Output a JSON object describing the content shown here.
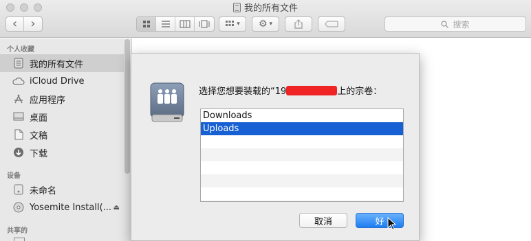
{
  "window": {
    "title": "我的所有文件",
    "search_placeholder": "搜索"
  },
  "toolbar": {
    "back_glyph": "‹",
    "forward_glyph": "›",
    "view_icons": [
      "view-icons-icon",
      "view-list-icon",
      "view-columns-icon",
      "view-coverflow-icon"
    ],
    "arrange_glyph": "▾",
    "action_glyph": "▾"
  },
  "sidebar": {
    "favorites_header": "个人收藏",
    "favorites": [
      {
        "label": "我的所有文件",
        "icon": "all-files-icon",
        "selected": true
      },
      {
        "label": "iCloud Drive",
        "icon": "cloud-icon"
      },
      {
        "label": "应用程序",
        "icon": "applications-icon"
      },
      {
        "label": "桌面",
        "icon": "desktop-icon"
      },
      {
        "label": "文稿",
        "icon": "documents-icon"
      },
      {
        "label": "下载",
        "icon": "downloads-icon"
      }
    ],
    "devices_header": "设备",
    "devices": [
      {
        "label": "未命名",
        "icon": "disk-icon"
      },
      {
        "label": "Yosemite Install(...",
        "icon": "install-disk-icon",
        "eject": "⏏"
      }
    ],
    "shared_header": "共享的"
  },
  "dialog": {
    "prompt_prefix": "选择您想要装载的“19",
    "prompt_suffix": "上的宗卷：",
    "volumes": [
      "Downloads",
      "Uploads"
    ],
    "selected_volume": "Uploads",
    "cancel_label": "取消",
    "ok_label": "好",
    "colors": {
      "selection": "#1760d3",
      "redaction": "#f02424"
    }
  }
}
